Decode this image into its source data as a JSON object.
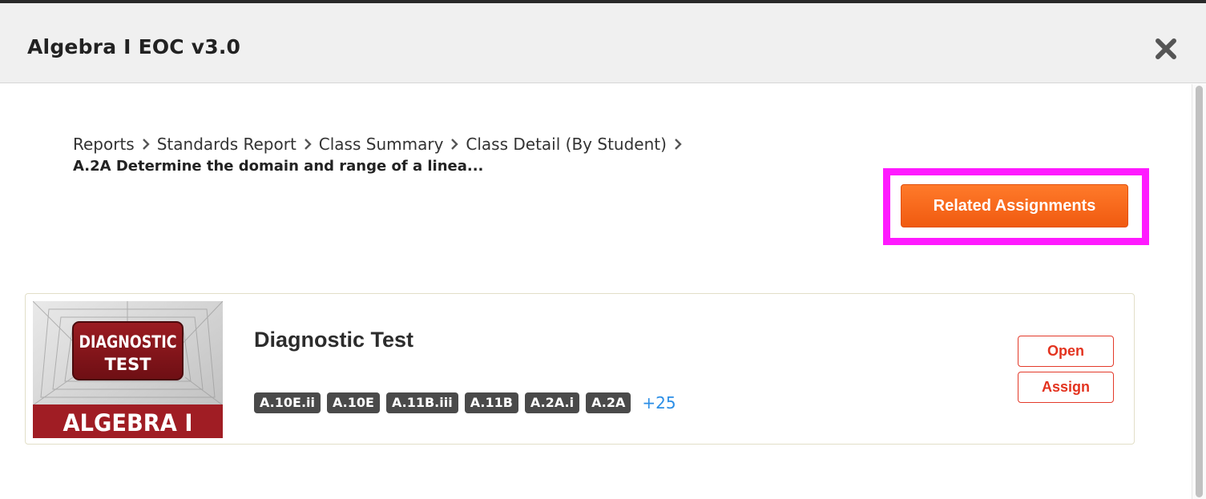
{
  "modal": {
    "title": "Algebra I EOC v3.0",
    "close_icon": "close-x-icon"
  },
  "breadcrumb": {
    "items": [
      "Reports",
      "Standards Report",
      "Class Summary",
      "Class Detail (By Student)"
    ],
    "separator_icon": "chevron-right-icon",
    "current": "A.2A Determine the domain and range of a linea..."
  },
  "actions": {
    "related_assignments_label": "Related Assignments",
    "accent_color": "#f26a1b",
    "highlight_color": "#ff1aff"
  },
  "assignment": {
    "title": "Diagnostic Test",
    "thumbnail": {
      "line1": "DIAGNOSTIC",
      "line2": "TEST",
      "subject": "ALGEBRA I"
    },
    "tags": [
      "A.10E.ii",
      "A.10E",
      "A.11B.iii",
      "A.11B",
      "A.2A.i",
      "A.2A"
    ],
    "more_tags": "+25",
    "open_label": "Open",
    "assign_label": "Assign"
  }
}
